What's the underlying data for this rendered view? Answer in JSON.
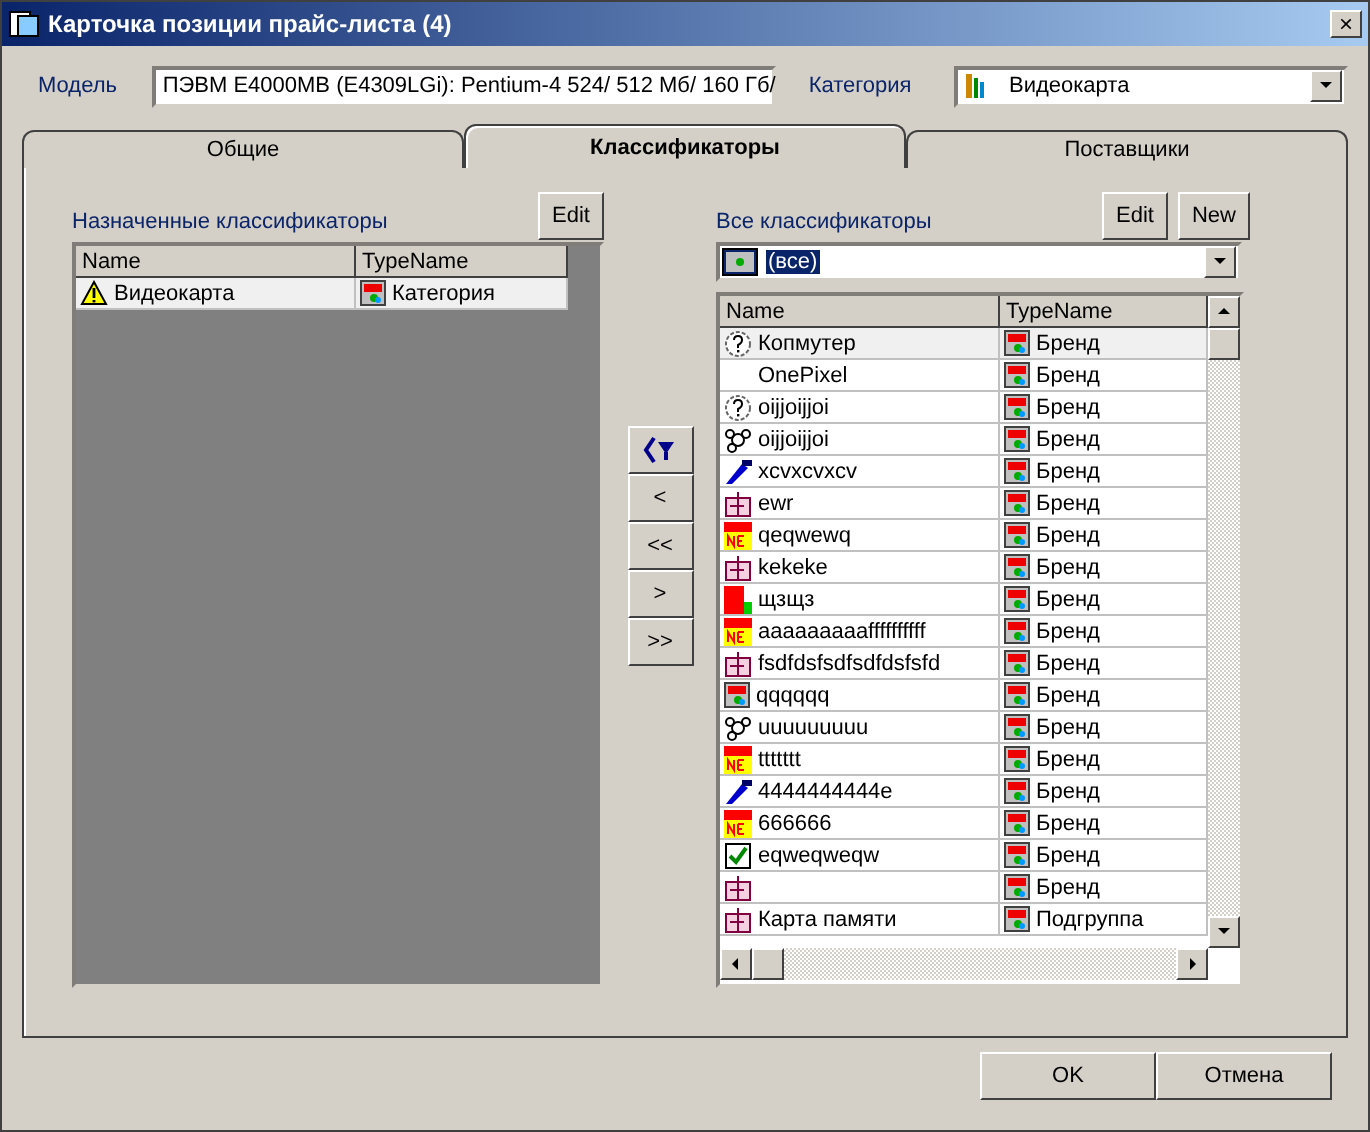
{
  "window": {
    "title": "Карточка позиции прайс-листа (4)",
    "close": "×"
  },
  "model": {
    "label": "Модель",
    "value": "ПЭВМ E4000MB (E4309LGi): Pentium-4 524/ 512 Мб/ 160 Гб/"
  },
  "category": {
    "label": "Категория",
    "value": "Видеокарта"
  },
  "tabs": [
    {
      "label": "Общие",
      "selected": false
    },
    {
      "label": "Классификаторы",
      "selected": true
    },
    {
      "label": "Поставщики",
      "selected": false
    }
  ],
  "assigned": {
    "label": "Назначенные классификаторы",
    "edit": "Edit",
    "columns": [
      "Name",
      "TypeName"
    ],
    "rows": [
      {
        "name": "Видеокарта",
        "type": "Категория",
        "selected": true
      }
    ]
  },
  "move_buttons": [
    "<",
    "<<",
    ">",
    ">>"
  ],
  "all": {
    "label": "Все классификаторы",
    "edit": "Edit",
    "new": "New",
    "filter": "(все)",
    "columns": [
      "Name",
      "TypeName"
    ],
    "rows": [
      {
        "name": "Копмутер",
        "type": "Бренд",
        "selected": true
      },
      {
        "name": "OnePixel",
        "type": "Бренд",
        "selected": false
      },
      {
        "name": "oijjoijjoi",
        "type": "Бренд",
        "selected": false
      },
      {
        "name": "oijjoijjoi",
        "type": "Бренд",
        "selected": false
      },
      {
        "name": "xcvxcvxcv",
        "type": "Бренд",
        "selected": false
      },
      {
        "name": "ewr",
        "type": "Бренд",
        "selected": false
      },
      {
        "name": "qeqwewq",
        "type": "Бренд",
        "selected": false
      },
      {
        "name": "kekeke",
        "type": "Бренд",
        "selected": false
      },
      {
        "name": "щзщз",
        "type": "Бренд",
        "selected": false
      },
      {
        "name": "aaaaaaaaaffffffffff",
        "type": "Бренд",
        "selected": false
      },
      {
        "name": "fsdfdsfsdfsdfdsfsfd",
        "type": "Бренд",
        "selected": false
      },
      {
        "name": "qqqqqq",
        "type": "Бренд",
        "selected": false
      },
      {
        "name": "uuuuuuuuu",
        "type": "Бренд",
        "selected": false
      },
      {
        "name": "ttttttt",
        "type": "Бренд",
        "selected": false
      },
      {
        "name": "4444444444e",
        "type": "Бренд",
        "selected": false
      },
      {
        "name": "666666",
        "type": "Бренд",
        "selected": false
      },
      {
        "name": "eqweqweqw",
        "type": "Бренд",
        "selected": false
      },
      {
        "type": "Бренд",
        "selected": false
      },
      {
        "name": "Карта памяти",
        "type": "Подгруппа",
        "selected": false
      }
    ]
  },
  "buttons": {
    "ok": "OK",
    "cancel": "Отмена"
  }
}
